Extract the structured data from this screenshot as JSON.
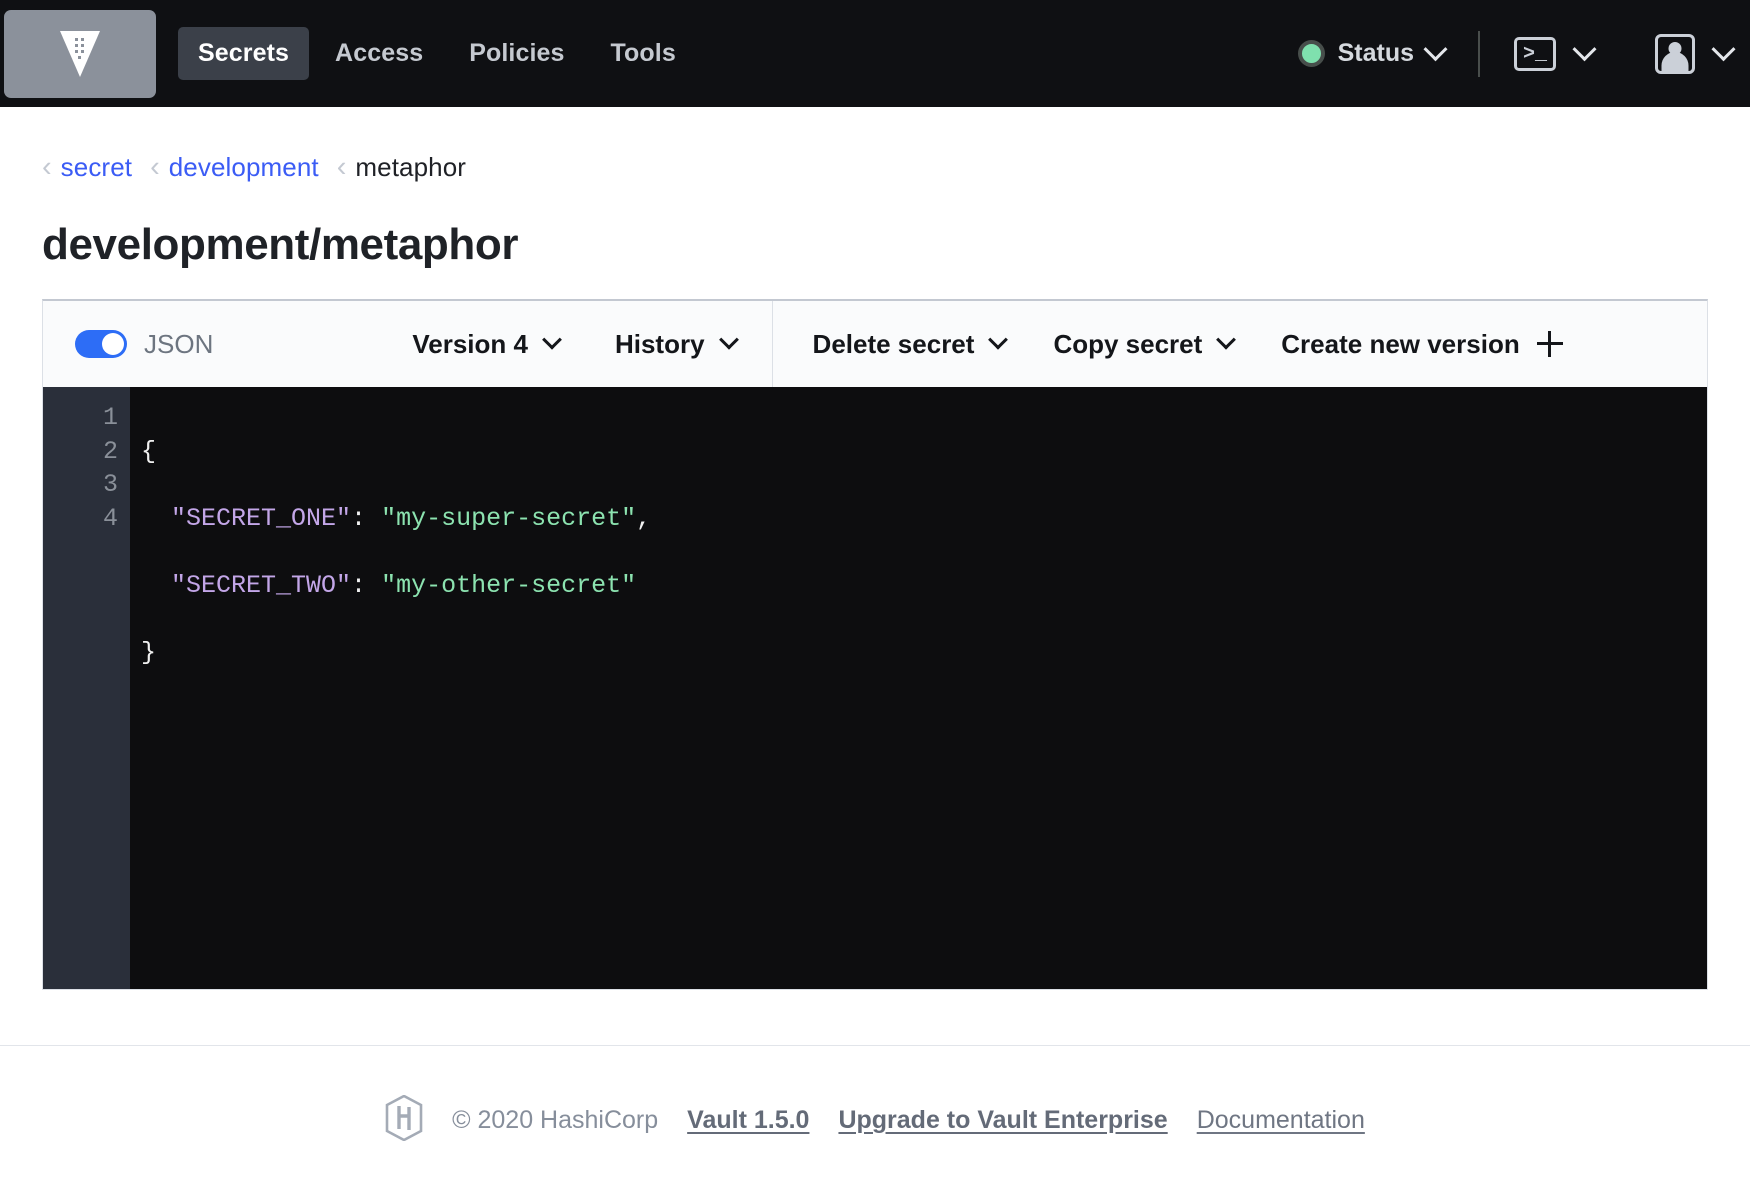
{
  "header": {
    "logo_icon": "vault-logo-icon",
    "nav_items": [
      {
        "label": "Secrets",
        "active": true
      },
      {
        "label": "Access",
        "active": false
      },
      {
        "label": "Policies",
        "active": false
      },
      {
        "label": "Tools",
        "active": false
      }
    ],
    "status_label": "Status",
    "status_color": "#7fe0ae",
    "console_icon": "terminal-console-icon",
    "user_icon": "user-avatar-icon"
  },
  "breadcrumb": {
    "sep": "‹",
    "items": [
      {
        "label": "secret",
        "current": false
      },
      {
        "label": "development",
        "current": false
      },
      {
        "label": "metaphor",
        "current": true
      }
    ]
  },
  "page": {
    "title": "development/metaphor"
  },
  "toolbar": {
    "json_toggle_label": "JSON",
    "json_toggle_on": true,
    "toggle_color": "#2d6df6",
    "version_label": "Version 4",
    "history_label": "History",
    "delete_secret_label": "Delete secret",
    "copy_secret_label": "Copy secret",
    "create_version_label": "Create new version"
  },
  "editor": {
    "line_numbers": [
      "1",
      "2",
      "3",
      "4"
    ],
    "key_color": "#c3a6e8",
    "string_color": "#8ce3b0",
    "background": "#0d0d0f",
    "gutter_background": "#2a2f3a",
    "lines": [
      {
        "punct_open": "{"
      },
      {
        "indent": "  ",
        "key": "\"SECRET_ONE\"",
        "colon": ": ",
        "value": "\"my-super-secret\"",
        "tail": ","
      },
      {
        "indent": "  ",
        "key": "\"SECRET_TWO\"",
        "colon": ": ",
        "value": "\"my-other-secret\"",
        "tail": ""
      },
      {
        "punct_close": "}"
      }
    ],
    "raw": "{\n  \"SECRET_ONE\": \"my-super-secret\",\n  \"SECRET_TWO\": \"my-other-secret\"\n}"
  },
  "footer": {
    "logo_icon": "hashicorp-logo-icon",
    "copyright": "© 2020 HashiCorp",
    "links": [
      {
        "label": "Vault 1.5.0",
        "bold": true
      },
      {
        "label": "Upgrade to Vault Enterprise",
        "bold": true
      },
      {
        "label": "Documentation",
        "bold": false
      }
    ]
  }
}
